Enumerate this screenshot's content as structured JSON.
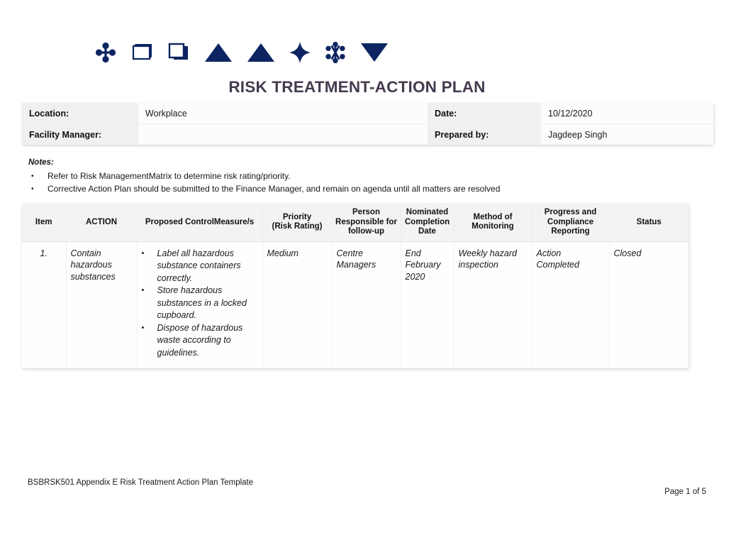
{
  "document": {
    "title": "RISK TREATMENT-ACTION PLAN",
    "title_color": "#453A4E",
    "accent_color": "#0C2461"
  },
  "logo": {
    "shapes": [
      "four-petal-cross-icon",
      "cube-outline-icon",
      "stacked-squares-icon",
      "triangle-up-icon",
      "triangle-up-icon",
      "four-point-star-icon",
      "asterisk-dots-icon",
      "triangle-down-icon"
    ]
  },
  "info": {
    "location_label": "Location:",
    "location_value": "Workplace",
    "date_label": "Date:",
    "date_value": "10/12/2020",
    "facility_manager_label": "Facility Manager:",
    "facility_manager_value": "",
    "prepared_by_label": "Prepared by:",
    "prepared_by_value": "Jagdeep Singh"
  },
  "notes": {
    "heading": "Notes:",
    "bullet": "•",
    "items": [
      "Refer to Risk ManagementMatrix to determine risk rating/priority.",
      "Corrective Action Plan should be submitted to the Finance Manager, and remain on agenda until all matters are resolved"
    ]
  },
  "plan_table": {
    "headers": {
      "item": "Item",
      "action": "ACTION",
      "control": "Proposed ControlMeasure/s",
      "priority_line1": "Priority",
      "priority_line2": "(Risk Rating)",
      "person_line1": "Person",
      "person_line2": "Responsible for",
      "person_line3": "follow-up",
      "nominated_line1": "Nominated",
      "nominated_line2": "Completion",
      "nominated_line3": "Date",
      "method_line1": "Method of",
      "method_line2": "Monitoring",
      "progress_line1": "Progress and",
      "progress_line2": "Compliance",
      "progress_line3": "Reporting",
      "status": "Status"
    },
    "bullet": "•",
    "rows": [
      {
        "item": "1.",
        "action": "Contain hazardous substances",
        "control_measures": [
          "Label all hazardous substance containers correctly.",
          "Store hazardous substances in a locked cupboard.",
          "Dispose of hazardous waste according to guidelines."
        ],
        "priority": "Medium",
        "person": "Centre Managers",
        "nominated_date": "End February 2020",
        "method": "Weekly hazard inspection",
        "progress": "Action Completed",
        "status": "Closed"
      }
    ]
  },
  "footer": {
    "left": "BSBRSK501 Appendix E Risk Treatment Action Plan Template",
    "right": "Page 1 of 5"
  }
}
